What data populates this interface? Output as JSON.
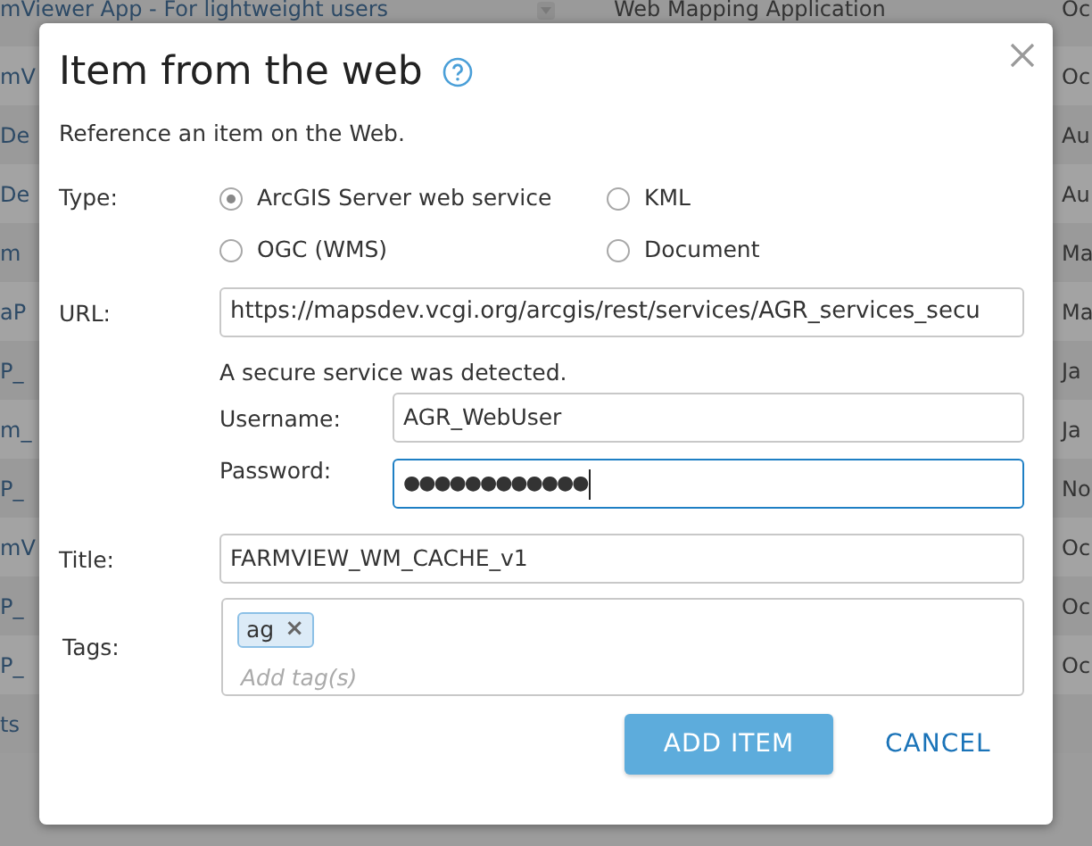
{
  "background_table": {
    "rows": [
      {
        "column_1": "mViewer App - For lightweight users",
        "column_2": "Web Mapping Application",
        "column_3": "Oc"
      },
      {
        "column_1": "mV",
        "column_3": "Oc"
      },
      {
        "column_1": "De",
        "column_3": "Au"
      },
      {
        "column_1": "De",
        "column_3": "Au"
      },
      {
        "column_1": "m",
        "column_3": "Ma"
      },
      {
        "column_1": "aP",
        "column_3": "Ma"
      },
      {
        "column_1": "P_",
        "column_3": "Ja"
      },
      {
        "column_1": "m_",
        "column_3": "Ja"
      },
      {
        "column_1": "P_",
        "column_3": "No"
      },
      {
        "column_1": "mV",
        "column_3": "Oc"
      },
      {
        "column_1": "P_",
        "column_3": "Oc"
      },
      {
        "column_1": "P_",
        "column_3": "Oc"
      },
      {
        "column_1": "ts"
      }
    ]
  },
  "dialog": {
    "title": "Item from the web",
    "description": "Reference an item on the Web.",
    "type": {
      "label": "Type:",
      "options": [
        {
          "label": "ArcGIS Server web service",
          "selected": true
        },
        {
          "label": "KML",
          "selected": false
        },
        {
          "label": "OGC (WMS)",
          "selected": false
        },
        {
          "label": "Document",
          "selected": false
        }
      ]
    },
    "url": {
      "label": "URL:",
      "value": "https://mapsdev.vcgi.org/arcgis/rest/services/AGR_services_secu"
    },
    "secure_notice": "A secure service was detected.",
    "username": {
      "label": "Username:",
      "value": "AGR_WebUser"
    },
    "password": {
      "label": "Password:",
      "value": "●●●●●●●●●●●●",
      "focused": true
    },
    "title_field": {
      "label": "Title:",
      "value": "FARMVIEW_WM_CACHE_v1"
    },
    "tags": {
      "label": "Tags:",
      "tags": [
        "ag"
      ],
      "remove": "×",
      "placeholder": "Add tag(s)"
    },
    "buttons": {
      "primary": "ADD ITEM",
      "secondary": "CANCEL"
    }
  }
}
